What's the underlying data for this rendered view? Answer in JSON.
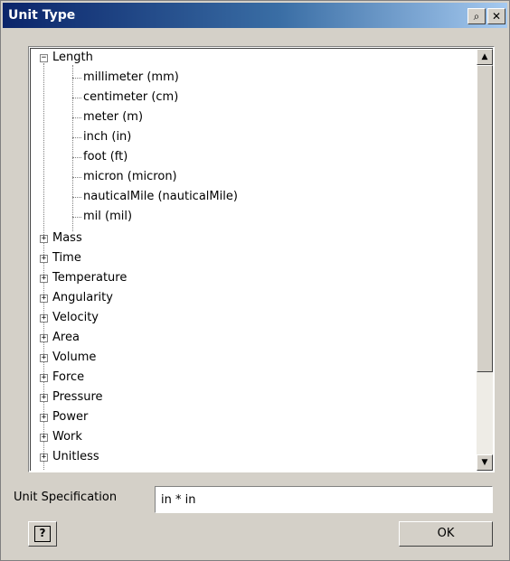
{
  "window": {
    "title": "Unit Type",
    "pin_glyph": "⌕",
    "close_glyph": "✕"
  },
  "tree": {
    "expanded": {
      "label": "Length",
      "expander": "−",
      "children": [
        "millimeter (mm)",
        "centimeter (cm)",
        "meter (m)",
        "inch (in)",
        "foot (ft)",
        "micron (micron)",
        "nauticalMile (nauticalMile)",
        "mil (mil)"
      ]
    },
    "collapsed": [
      "Mass",
      "Time",
      "Temperature",
      "Angularity",
      "Velocity",
      "Area",
      "Volume",
      "Force",
      "Pressure",
      "Power",
      "Work",
      "Unitless"
    ],
    "collapsed_expander": "+"
  },
  "scrollbar": {
    "up_glyph": "▲",
    "down_glyph": "▼"
  },
  "spec": {
    "label": "Unit Specification",
    "value": "in * in"
  },
  "buttons": {
    "help_glyph": "?",
    "ok_label": "OK"
  }
}
